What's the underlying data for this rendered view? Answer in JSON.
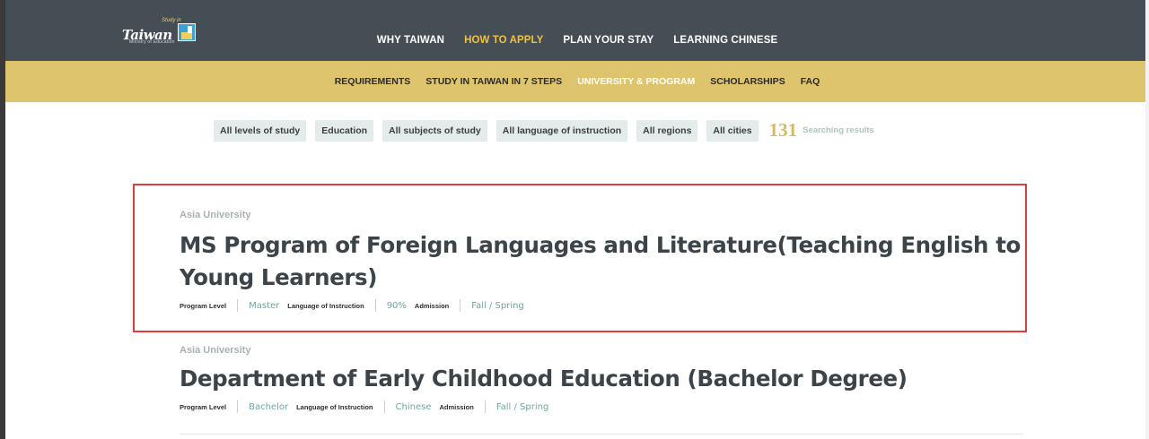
{
  "logo": {
    "text": "Taiwan",
    "tag": "Study in",
    "subtext": "Ministry of Education"
  },
  "main_nav": [
    {
      "label": "WHY TAIWAN",
      "active": false
    },
    {
      "label": "HOW TO APPLY",
      "active": true
    },
    {
      "label": "PLAN YOUR STAY",
      "active": false
    },
    {
      "label": "LEARNING CHINESE",
      "active": false
    }
  ],
  "sub_nav": [
    {
      "label": "REQUIREMENTS",
      "active": false
    },
    {
      "label": "STUDY IN TAIWAN IN 7 STEPS",
      "active": false
    },
    {
      "label": "UNIVERSITY & PROGRAM",
      "active": true
    },
    {
      "label": "SCHOLARSHIPS",
      "active": false
    },
    {
      "label": "FAQ",
      "active": false
    }
  ],
  "filters": {
    "level": "All levels of study",
    "field": "Education",
    "subject": "All subjects of study",
    "language": "All language of instruction",
    "region": "All regions",
    "city": "All cities"
  },
  "results": {
    "count": "131",
    "label": "Searching results"
  },
  "programs": [
    {
      "university": "Asia University",
      "title": "MS Program of Foreign Languages and Literature(Teaching English to Young Learners)",
      "level_label": "Program Level",
      "level": "Master",
      "language_label": "Language of Instruction",
      "language": "90%",
      "admission_label": "Admission",
      "admission": "Fall / Spring"
    },
    {
      "university": "Asia University",
      "title": "Department of Early Childhood Education (Bachelor Degree)",
      "level_label": "Program Level",
      "level": "Bachelor",
      "language_label": "Language of Instruction",
      "language": "Chinese",
      "admission_label": "Admission",
      "admission": "Fall / Spring"
    }
  ],
  "colors": {
    "topbar": "#454d55",
    "subnav": "#dfc46e",
    "active_main": "#f0c33c",
    "highlight_border": "#e03c3c",
    "meta_value": "#72a4a0"
  }
}
